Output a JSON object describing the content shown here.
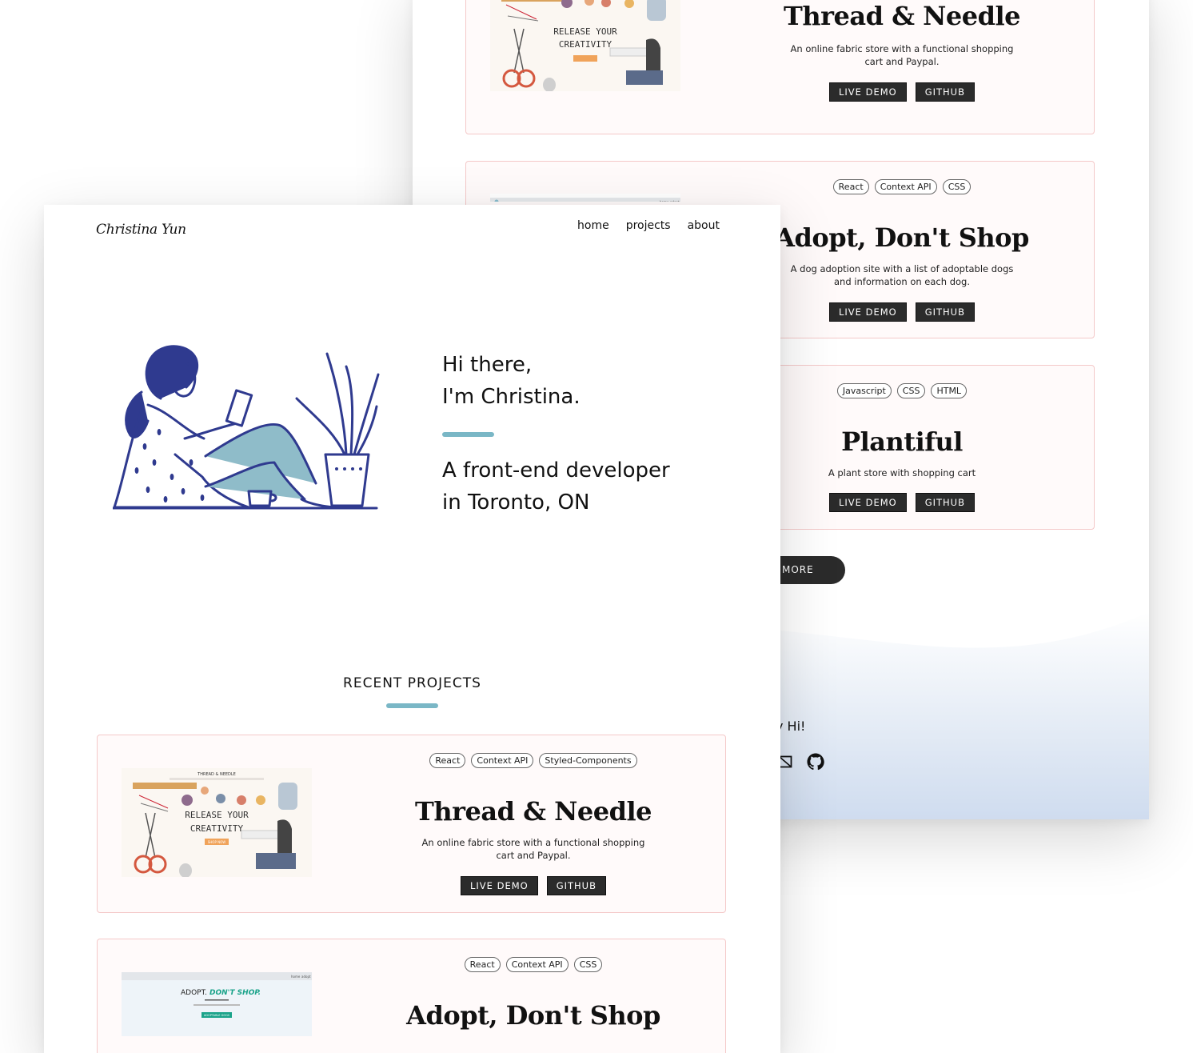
{
  "back": {
    "projects": [
      {
        "tags": [],
        "title": "Thread & Needle",
        "desc": "An online fabric store with a functional shopping cart and Paypal.",
        "live": "LIVE DEMO",
        "github": "GITHUB"
      },
      {
        "tags": [
          "React",
          "Context API",
          "CSS"
        ],
        "title": "Adopt, Don't Shop",
        "desc": "A dog adoption site with a list of adoptable dogs and information on each dog.",
        "live": "LIVE DEMO",
        "github": "GITHUB"
      },
      {
        "tags": [
          "Javascript",
          "CSS",
          "HTML"
        ],
        "title": "Plantiful",
        "desc": "A plant store with shopping cart",
        "live": "LIVE DEMO",
        "github": "GITHUB"
      }
    ],
    "more_button": "MORE",
    "say_hi": "y Hi!",
    "icons": [
      "mail-icon",
      "github-icon"
    ]
  },
  "front": {
    "logo": "Christina Yun",
    "nav": {
      "home": "home",
      "projects": "projects",
      "about": "about"
    },
    "hero": {
      "line1": "Hi there,",
      "line2": "I'm Christina.",
      "line3": "A front-end developer",
      "line4": "in Toronto, ON"
    },
    "section_title": "RECENT PROJECTS",
    "projects": [
      {
        "tags": [
          "React",
          "Context API",
          "Styled-Components"
        ],
        "title": "Thread & Needle",
        "desc": "An online fabric store with a functional shopping cart and Paypal.",
        "live": "LIVE DEMO",
        "github": "GITHUB"
      },
      {
        "tags": [
          "React",
          "Context API",
          "CSS"
        ],
        "title": "Adopt, Don't Shop"
      }
    ]
  },
  "thumbs": {
    "tn_line1": "RELEASE YOUR",
    "tn_line2": "CREATIVITY",
    "tn_shop": "SHOP NOW",
    "tn_brand": "THREAD & NEEDLE",
    "ad_adopt": "ADOPT.",
    "ad_dont": "DON'T SHOP.",
    "ad_btn": "ADOPTABLE DOGS",
    "nav_home": "home",
    "nav_adopt": "adopt"
  },
  "colors": {
    "accent": "#7ab7c6",
    "card_border": "#f4c9c9",
    "card_bg": "#fffafa",
    "button": "#2b2b2b",
    "illustration": "#2f3a8f",
    "illustration_fill": "#8fbcc9"
  }
}
